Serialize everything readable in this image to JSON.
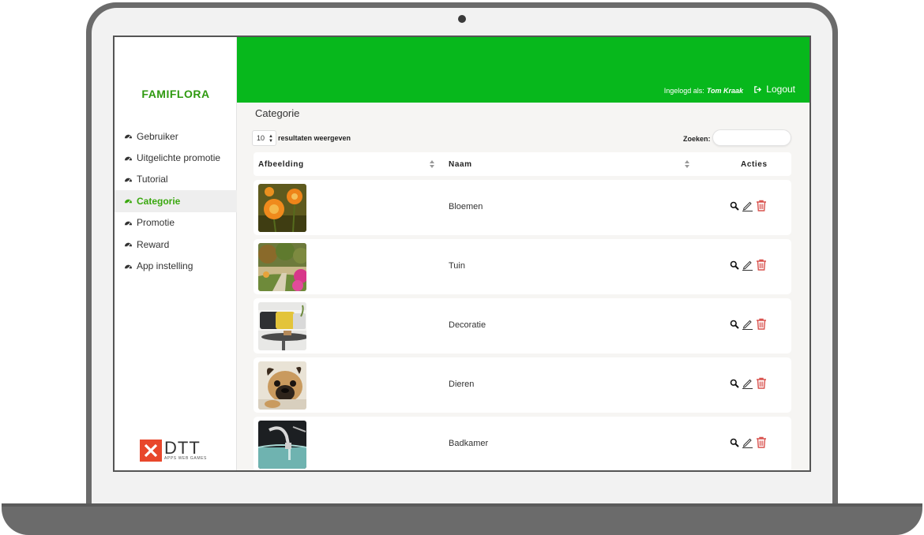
{
  "app": {
    "brand": "FAMIFLORA",
    "logo_word": "DTT",
    "logo_sub": "APPS WEB GAMES"
  },
  "colors": {
    "header_green": "#07b81c",
    "brand_green": "#2f9a10",
    "active_green": "#3aa80f",
    "delete_red": "#d9534f",
    "logo_orange": "#e8472b"
  },
  "sidebar": {
    "items": [
      {
        "label": "Gebruiker",
        "icon": "dashboard-icon",
        "active": false
      },
      {
        "label": "Uitgelichte promotie",
        "icon": "dashboard-icon",
        "active": false
      },
      {
        "label": "Tutorial",
        "icon": "dashboard-icon",
        "active": false
      },
      {
        "label": "Categorie",
        "icon": "dashboard-icon",
        "active": true
      },
      {
        "label": "Promotie",
        "icon": "dashboard-icon",
        "active": false
      },
      {
        "label": "Reward",
        "icon": "dashboard-icon",
        "active": false
      },
      {
        "label": "App instelling",
        "icon": "dashboard-icon",
        "active": false
      }
    ]
  },
  "header": {
    "logged_in_label": "Ingelogd als:",
    "user_name": "Tom Kraak",
    "logout_label": "Logout"
  },
  "page": {
    "title": "Categorie",
    "length_value": "10",
    "length_label": "resultaten weergeven",
    "search_label": "Zoeken:",
    "search_value": ""
  },
  "table": {
    "columns": [
      "Afbeelding",
      "Naam",
      "Acties"
    ],
    "rows": [
      {
        "name": "Bloemen",
        "image": "flowers-photo"
      },
      {
        "name": "Tuin",
        "image": "garden-photo"
      },
      {
        "name": "Decoratie",
        "image": "decoration-photo"
      },
      {
        "name": "Dieren",
        "image": "dog-photo"
      },
      {
        "name": "Badkamer",
        "image": "bathroom-photo"
      }
    ]
  }
}
